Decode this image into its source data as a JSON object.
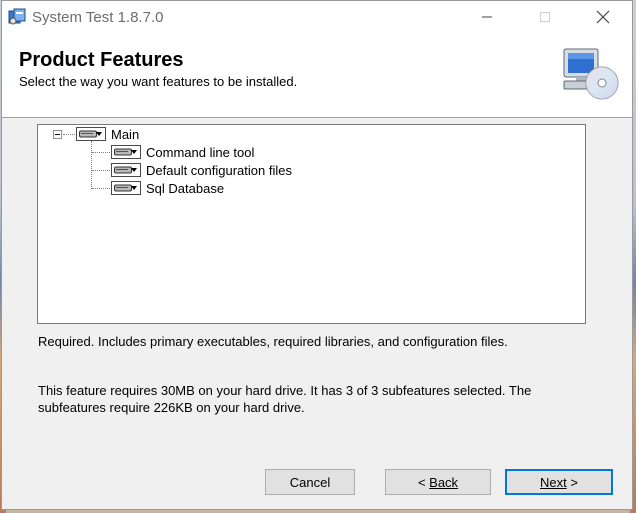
{
  "window": {
    "title": "System Test 1.8.7.0"
  },
  "header": {
    "title": "Product Features",
    "subtitle": "Select the way you want features to be installed."
  },
  "tree": {
    "root": {
      "label": "Main",
      "icon": "hard-drive-icon",
      "expanded": true
    },
    "children": [
      {
        "label": "Command line tool",
        "icon": "hard-drive-icon"
      },
      {
        "label": "Default configuration files",
        "icon": "hard-drive-icon"
      },
      {
        "label": "Sql Database",
        "icon": "hard-drive-icon"
      }
    ]
  },
  "description": "Required. Includes primary executables, required libraries, and configuration files.",
  "size_info": "This feature requires 30MB on your hard drive. It has 3 of 3 subfeatures selected. The subfeatures require 226KB on your hard drive.",
  "buttons": {
    "cancel": "Cancel",
    "back_arrow": "<",
    "back": "Back",
    "next": "Next",
    "next_arrow": ">"
  },
  "colors": {
    "accent": "#0078d7",
    "window_bg": "#f0f0f0"
  }
}
